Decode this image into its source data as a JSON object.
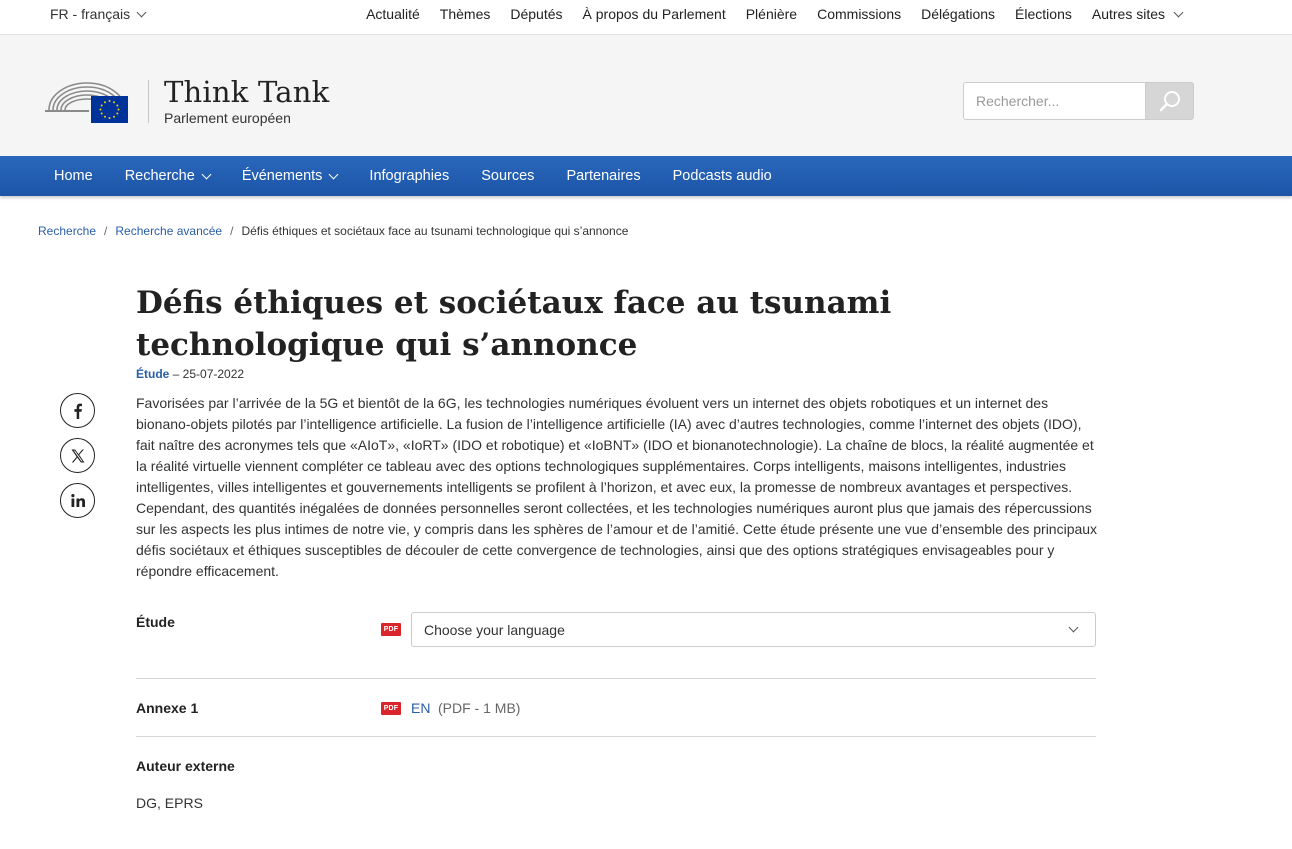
{
  "topbar": {
    "language": "FR - français",
    "links": [
      "Actualité",
      "Thèmes",
      "Députés",
      "À propos du Parlement",
      "Plénière",
      "Commissions",
      "Délégations",
      "Élections"
    ],
    "more": "Autres sites"
  },
  "header": {
    "title": "Think Tank",
    "subtitle": "Parlement européen",
    "search_placeholder": "Rechercher...",
    "colors": {
      "eu_blue": "#003399",
      "eu_star": "#ffcc00"
    }
  },
  "mainnav": {
    "home": "Home",
    "recherche": "Recherche",
    "evenements": "Événements",
    "infographies": "Infographies",
    "sources": "Sources",
    "partenaires": "Partenaires",
    "podcasts": "Podcasts audio",
    "color": "#1e5db3"
  },
  "breadcrumb": {
    "item1": "Recherche",
    "item2": "Recherche avancée",
    "current": "Défis éthiques et sociétaux face au tsunami technologique qui s’annonce"
  },
  "share": {
    "facebook": "facebook-icon",
    "x": "x-icon",
    "linkedin": "linkedin-icon"
  },
  "article": {
    "title": "Défis éthiques et sociétaux face au tsunami technologique qui s’annonce",
    "type": "Étude",
    "date": " – 25-07-2022",
    "abstract": "Favorisées par l’arrivée de la 5G et bientôt de la 6G, les technologies numériques évoluent vers un internet des objets robotiques et un internet des bionano-objets pilotés par l’intelligence artificielle. La fusion de l’intelligence artificielle (IA) avec d’autres technologies, comme l’internet des objets (IDO), fait naître des acronymes tels que «AIoT», «IoRT» (IDO et robotique) et «IoBNT» (IDO et bionanotechnologie). La chaîne de blocs, la réalité augmentée et la réalité virtuelle viennent compléter ce tableau avec des options technologiques supplémentaires. Corps intelligents, maisons intelligentes, industries intelligentes, villes intelligentes et gouvernements intelligents se profilent à l’horizon, et avec eux, la promesse de nombreux avantages et perspectives. Cependant, des quantités inégalées de données personnelles seront collectées, et les technologies numériques auront plus que jamais des répercussions sur les aspects les plus intimes de notre vie, y compris dans les sphères de l’amour et de l’amitié. Cette étude présente une vue d’ensemble des principaux défis sociétaux et éthiques susceptibles de découler de cette convergence de technologies, ainsi que des options stratégiques envisageables pour y répondre efficacement."
  },
  "documents": {
    "pdf_badge": "PDF",
    "etude_label": "Étude",
    "language_select": "Choose your language",
    "annex_label": "Annexe 1",
    "annex_lang": "EN",
    "annex_size": "(PDF - 1 MB)",
    "author_label": "Auteur externe",
    "author_value": "DG, EPRS",
    "pdf_color": "#d9262c"
  }
}
